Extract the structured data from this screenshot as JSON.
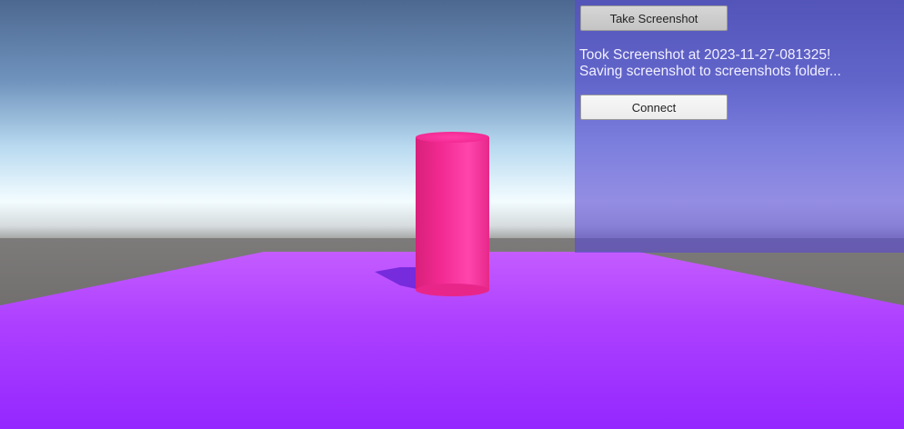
{
  "window": {
    "title": ""
  },
  "ui": {
    "take_screenshot_label": "Take Screenshot",
    "status_lines": [
      "Took Screenshot at 2023-11-27-081325!",
      "Saving screenshot to screenshots folder..."
    ],
    "connect_label": "Connect"
  },
  "scene": {
    "objects": [
      {
        "name": "cylinder",
        "color": "#ff2f9e"
      },
      {
        "name": "floor-plane",
        "color": "#b040ff"
      }
    ],
    "sky_colors": {
      "top": "#4a6d9c",
      "horizon": "#f2fbff",
      "ground": "#757271"
    }
  }
}
